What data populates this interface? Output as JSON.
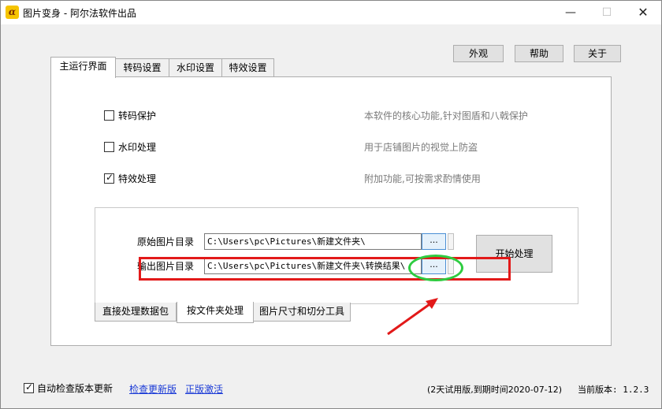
{
  "window": {
    "title": "图片变身 - 阿尔法软件出品",
    "icon_text": "α",
    "controls": {
      "minimize": "—",
      "maximize": "☐",
      "close": "✕"
    }
  },
  "toolbar": {
    "appearance": "外观",
    "help": "帮助",
    "about": "关于"
  },
  "tabs": [
    {
      "label": "主运行界面",
      "active": true
    },
    {
      "label": "转码设置",
      "active": false
    },
    {
      "label": "水印设置",
      "active": false
    },
    {
      "label": "特效设置",
      "active": false
    }
  ],
  "options": [
    {
      "label": "转码保护",
      "checked": false,
      "desc": "本软件的核心功能,针对图盾和八戟保护"
    },
    {
      "label": "水印处理",
      "checked": false,
      "desc": "用于店铺图片的视觉上防盗"
    },
    {
      "label": "特效处理",
      "checked": true,
      "desc": "附加功能,可按需求酌情使用"
    }
  ],
  "folders": {
    "source_label": "原始图片目录",
    "source_path": "C:\\Users\\pc\\Pictures\\新建文件夹\\",
    "output_label": "输出图片目录",
    "output_path": "C:\\Users\\pc\\Pictures\\新建文件夹\\转换结果\\",
    "browse": "...",
    "start": "开始处理"
  },
  "bottom_tabs": [
    {
      "label": "直接处理数据包",
      "active": false
    },
    {
      "label": "按文件夹处理",
      "active": true
    },
    {
      "label": "图片尺寸和切分工具",
      "active": false
    }
  ],
  "footer": {
    "auto_check_label": "自动检查版本更新",
    "auto_check_checked": true,
    "check_update": "检查更新版",
    "activate": "正版激活",
    "trial": "(2天试用版,到期时间2020-07-12)",
    "version_label": "当前版本: ",
    "version": "1.2.3"
  },
  "colors": {
    "highlight_box": "#e21919",
    "highlight_ellipse": "#2ecc40",
    "arrow": "#e21919",
    "link": "#1a3ad6"
  }
}
